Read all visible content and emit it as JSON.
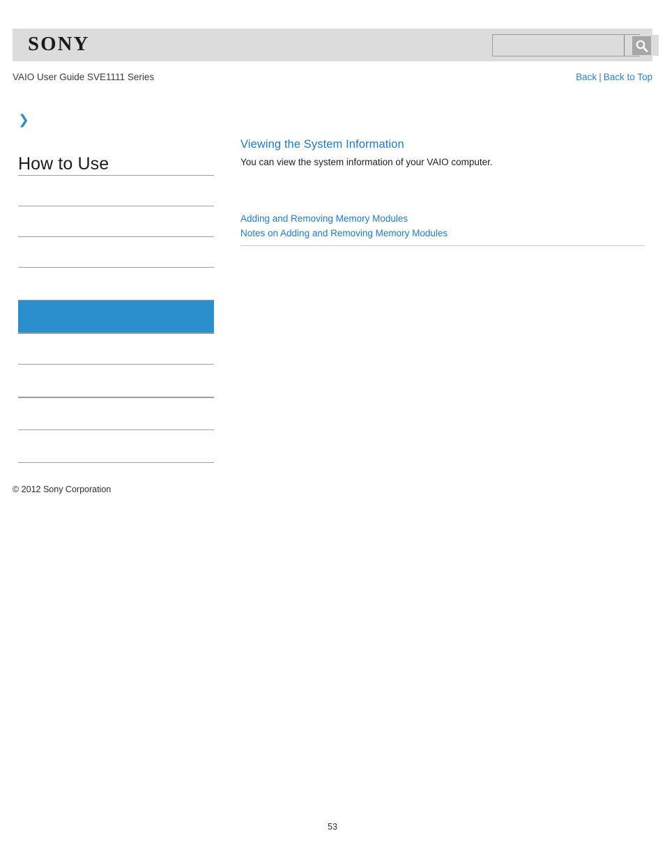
{
  "header": {
    "brand": "SONY",
    "brand_icon": "sony-wordmark"
  },
  "search": {
    "value": "",
    "placeholder": "",
    "button_icon": "search-icon",
    "button_label": ""
  },
  "nav": {
    "guide_title": "VAIO User Guide SVE1111 Series",
    "back_label": "Back",
    "separator": "|",
    "back_to_top_label": "Back to Top"
  },
  "sidebar": {
    "chevron_icon": "chevron-right-icon",
    "title": "How to Use",
    "items": [
      {
        "label": "",
        "state": "normal"
      },
      {
        "label": "",
        "state": "normal"
      },
      {
        "label": "",
        "state": "normal"
      },
      {
        "label": "",
        "state": "normal"
      },
      {
        "label": "",
        "state": "active"
      },
      {
        "label": "",
        "state": "normal"
      },
      {
        "label": "",
        "state": "normal"
      },
      {
        "label": "",
        "state": "thick"
      },
      {
        "label": "",
        "state": "normal"
      },
      {
        "label": "",
        "state": "normal"
      }
    ],
    "copyright": "© 2012 Sony Corporation"
  },
  "main": {
    "topic_title": "Viewing the System Information",
    "topic_description": "You can view the system information of your VAIO computer.",
    "related_links": [
      "Adding and Removing Memory Modules",
      "Notes on Adding and Removing Memory Modules"
    ]
  },
  "footer": {
    "page_number": "53"
  },
  "colors": {
    "header_band": "#dcdcdc",
    "accent_blue": "#2b8ecd",
    "link_blue": "#1f79c8",
    "nav_link_blue": "#2b7fd4",
    "rule_gray": "#9d9d9d",
    "content_rule_gray": "#c8c8c8"
  }
}
